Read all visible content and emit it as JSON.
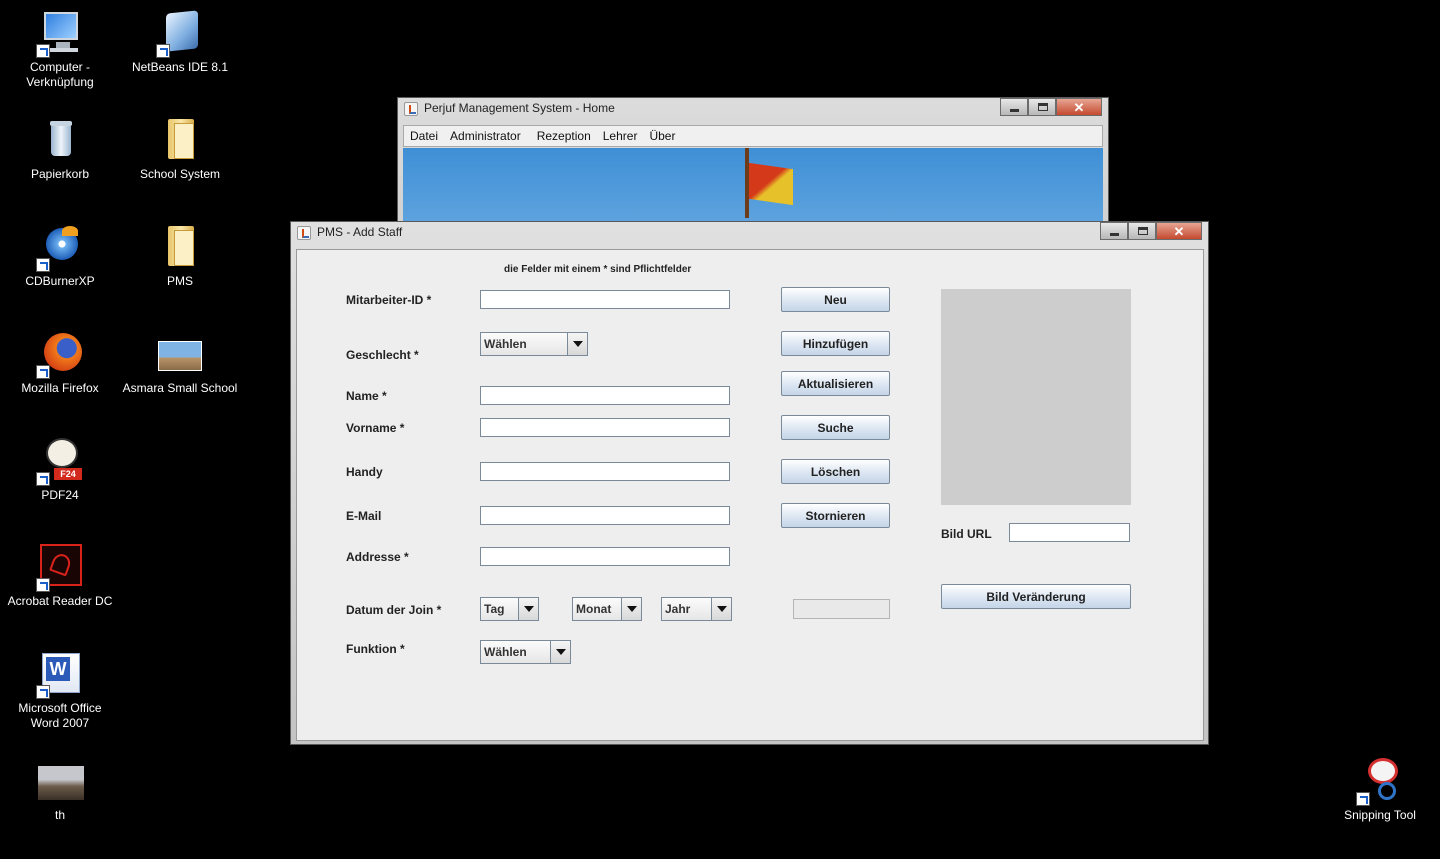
{
  "desktop": {
    "icons": [
      {
        "label": "Computer -\nVerknüpfung",
        "icon": "computer-icon"
      },
      {
        "label": "NetBeans IDE 8.1",
        "icon": "netbeans-icon"
      },
      {
        "label": "Papierkorb",
        "icon": "recycle-bin-icon"
      },
      {
        "label": "School System",
        "icon": "folder-icon"
      },
      {
        "label": "CDBurnerXP",
        "icon": "cdburner-icon"
      },
      {
        "label": "PMS",
        "icon": "folder-icon"
      },
      {
        "label": "Mozilla Firefox",
        "icon": "firefox-icon"
      },
      {
        "label": "Asmara Small School",
        "icon": "photo-icon"
      },
      {
        "label": "PDF24",
        "icon": "pdf24-icon"
      },
      {
        "label": "Acrobat Reader DC",
        "icon": "acrobat-icon"
      },
      {
        "label": "Microsoft Office\nWord 2007",
        "icon": "word-icon"
      },
      {
        "label": "th",
        "icon": "photo-icon"
      },
      {
        "label": "Snipping Tool",
        "icon": "snipping-tool-icon"
      }
    ]
  },
  "home_window": {
    "title": "Perjuf Management System - Home",
    "menu": [
      "Datei",
      "Administrator",
      "Rezeption",
      "Lehrer",
      "Über"
    ]
  },
  "staff_window": {
    "title": "PMS - Add Staff",
    "hint": "die Felder mit einem * sind Pflichtfelder",
    "labels": {
      "id": "Mitarbeiter-ID *",
      "gender": "Geschlecht *",
      "name": "Name *",
      "firstname": "Vorname *",
      "mobile": "Handy",
      "email": "E-Mail",
      "address": "Addresse *",
      "join_date": "Datum der Join *",
      "function": "Funktion *",
      "image_url": "Bild URL"
    },
    "combos": {
      "gender": "Wählen",
      "day": "Tag",
      "month": "Monat",
      "year": "Jahr",
      "function": "Wählen"
    },
    "buttons": {
      "new": "Neu",
      "add": "Hinzufügen",
      "update": "Aktualisieren",
      "search": "Suche",
      "delete": "Löschen",
      "cancel": "Stornieren",
      "change_image": "Bild Veränderung"
    }
  },
  "window_controls": {
    "close": "✕"
  }
}
